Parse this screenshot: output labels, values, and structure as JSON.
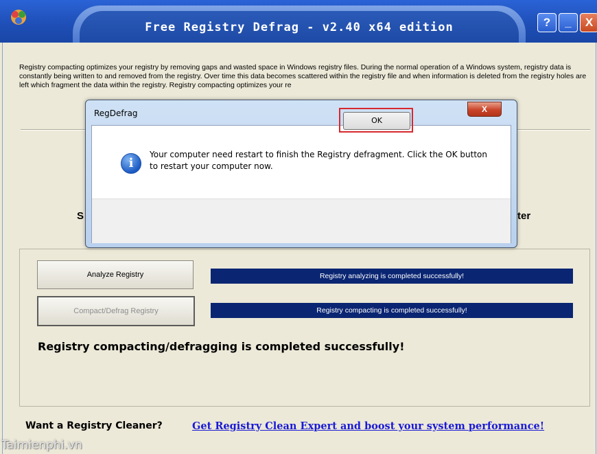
{
  "window": {
    "title": "Free Registry Defrag - v2.40 x64 edition",
    "help_label": "?",
    "minimize_label": "_",
    "close_label": "X"
  },
  "main": {
    "description": "Registry compacting optimizes your registry by removing gaps and wasted space in Windows registry files. During the normal operation of a Windows system, registry data is constantly being written to and removed from the registry. Over time this data becomes scattered within the registry file and when information is deleted from the registry holes are left which fragment the data within the registry. Registry compacting optimizes your re",
    "partial_left": "S",
    "partial_right": "ter",
    "analyze_button": "Analyze Registry",
    "analyze_status": "Registry analyzing is completed successfully!",
    "compact_button": "Compact/Defrag Registry",
    "compact_status": "Registry compacting is completed successfully!",
    "completed_message": "Registry compacting/defragging is completed successfully!",
    "cleaner_label": "Want a Registry Cleaner?",
    "cleaner_link": "Get Registry Clean Expert and boost your system performance!"
  },
  "dialog": {
    "title": "RegDefrag",
    "close_label": "X",
    "message": "Your computer need restart to finish the Registry defragment. Click the OK button to restart your computer now.",
    "ok_label": "OK",
    "icon": "info-icon"
  },
  "watermark": "Taimienphi.vn",
  "colors": {
    "titlebar": "#2a63d6",
    "status_bar": "#0a2572",
    "link": "#1a1ad6",
    "highlight": "#d6282e"
  }
}
